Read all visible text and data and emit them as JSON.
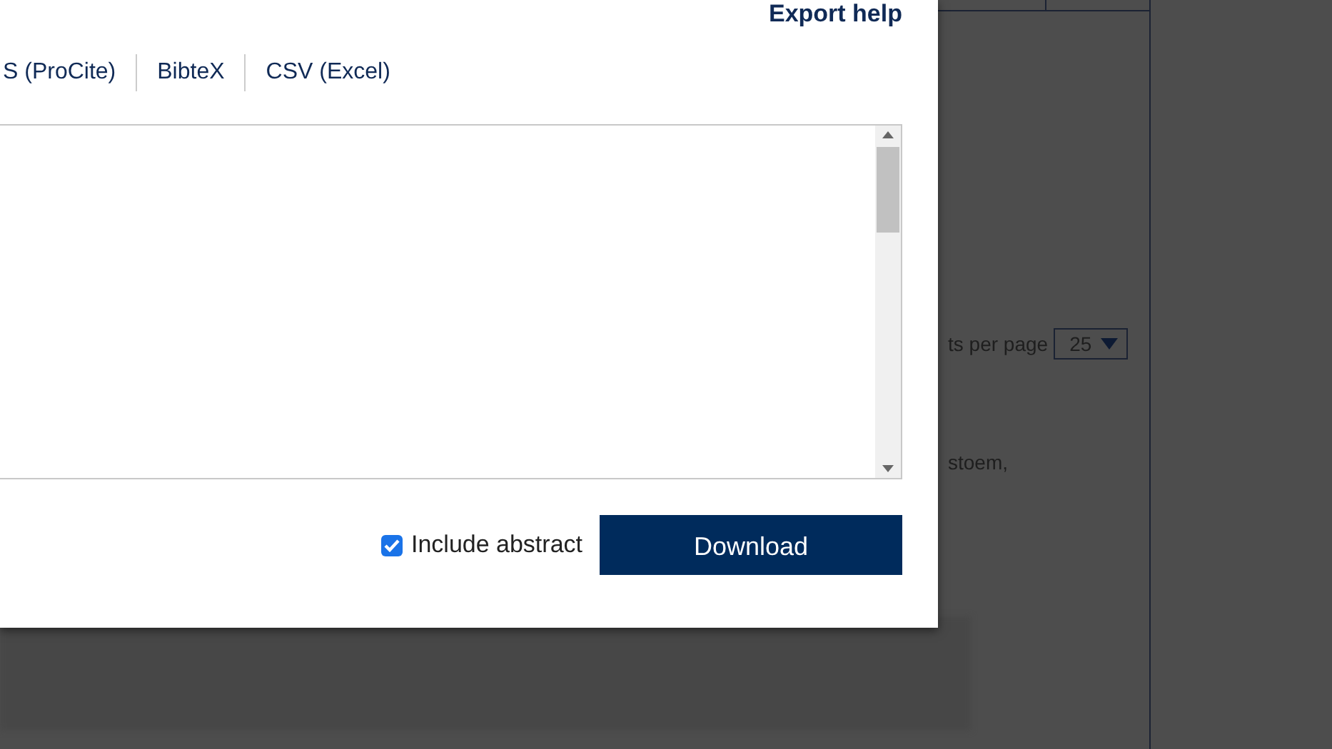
{
  "background_page": {
    "per_page_label": "ts per page",
    "per_page_value": "25",
    "snippet": "stoem,"
  },
  "dialog": {
    "help_link": "Export help",
    "formats": [
      {
        "label": "S (ProCite)"
      },
      {
        "label": "BibteX"
      },
      {
        "label": "CSV (Excel)"
      }
    ],
    "include_abstract": {
      "label": "Include abstract",
      "checked": true
    },
    "download_button": "Download"
  }
}
